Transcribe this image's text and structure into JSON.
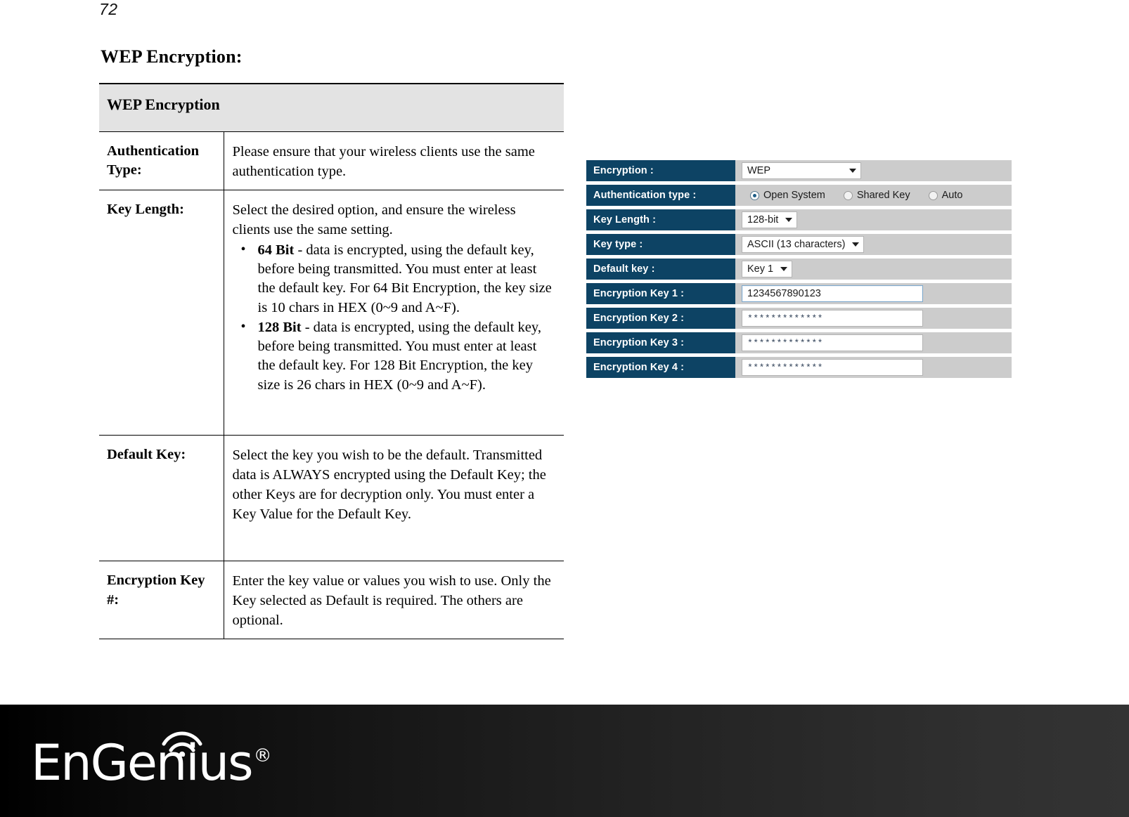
{
  "page": {
    "number": "72",
    "heading": "WEP Encryption:"
  },
  "doc_table": {
    "header": "WEP Encryption",
    "rows": [
      {
        "label": "Authentication Type:",
        "paragraphs": [
          "Please ensure that your wireless clients use the same authentication type."
        ],
        "bullets": []
      },
      {
        "label": "Key Length:",
        "paragraphs": [
          "Select the desired option, and ensure the wireless clients use the same setting."
        ],
        "bullets": [
          {
            "term": "64 Bit",
            "text": " - data is encrypted, using the default key, before being transmitted. You must enter at least the default key. For 64 Bit Encryption, the key size is 10 chars in HEX (0~9 and A~F)."
          },
          {
            "term": "128 Bit",
            "text": " - data is encrypted, using the default key, before being transmitted. You must enter at least the default key. For 128 Bit Encryption, the key size is 26 chars in HEX (0~9 and A~F)."
          }
        ]
      },
      {
        "label": "Default Key:",
        "paragraphs": [
          "Select the key you wish to be the default. Transmitted data is ALWAYS encrypted using the Default Key; the other Keys are for decryption only. You must enter a Key Value for the Default Key."
        ],
        "bullets": []
      },
      {
        "label": "Encryption Key #:",
        "paragraphs": [
          "Enter the key value or values you wish to use. Only the Key selected as Default is required. The others are optional."
        ],
        "bullets": []
      }
    ]
  },
  "config_panel": {
    "colors": {
      "label_bg": "#0d4364",
      "value_bg": "#cccccc",
      "input_bg": "#ffffff",
      "radio_accent": "#1d5d86"
    },
    "rows": [
      {
        "label": "Encryption :",
        "type": "select",
        "value": "WEP"
      },
      {
        "label": "Authentication type :",
        "type": "radio",
        "options": [
          {
            "label": "Open System",
            "checked": true
          },
          {
            "label": "Shared Key",
            "checked": false
          },
          {
            "label": "Auto",
            "checked": false
          }
        ]
      },
      {
        "label": "Key Length :",
        "type": "select",
        "value": "128-bit"
      },
      {
        "label": "Key type :",
        "type": "select",
        "value": "ASCII (13 characters)"
      },
      {
        "label": "Default key :",
        "type": "select",
        "value": "Key 1"
      },
      {
        "label": "Encryption Key 1 :",
        "type": "text",
        "value": "1234567890123",
        "focused": true
      },
      {
        "label": "Encryption Key 2 :",
        "type": "text",
        "value": "*************",
        "masked": true
      },
      {
        "label": "Encryption Key 3 :",
        "type": "text",
        "value": "*************",
        "masked": true
      },
      {
        "label": "Encryption Key 4 :",
        "type": "text",
        "value": "*************",
        "masked": true
      }
    ]
  },
  "footer": {
    "brand": "EnGenius",
    "registered_mark": "®",
    "wifi_icon": "wifi-arcs-icon"
  }
}
